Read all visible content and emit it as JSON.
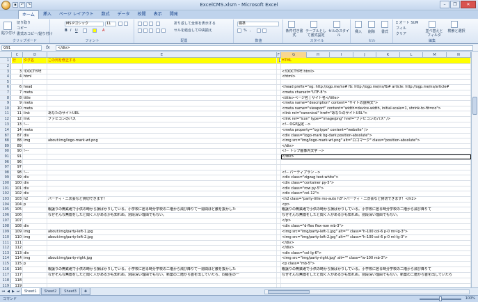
{
  "app": {
    "title": "ExcelCMS.xlsm - Microsoft Excel"
  },
  "ribbon": {
    "tabs": [
      "ホーム",
      "挿入",
      "ページ レイアウト",
      "数式",
      "データ",
      "校閲",
      "表示",
      "開発"
    ],
    "clipboard": {
      "paste": "貼り付け",
      "cut": "切り取り",
      "copy": "コピー",
      "format_painter": "書式のコピー/貼り付け",
      "label": "クリップボード"
    },
    "font": {
      "name": "MS Pゴシック",
      "size": "11",
      "label": "フォント"
    },
    "alignment": {
      "wrap": "折り返して全体を表示する",
      "merge": "セルを結合して中央揃え",
      "label": "配置"
    },
    "number": {
      "format": "標準",
      "label": "数値"
    },
    "styles": {
      "conditional": "条件付き書式",
      "table": "テーブルとして書式設定",
      "cell": "セルのスタイル",
      "label": "スタイル"
    },
    "cells": {
      "insert": "挿入",
      "delete": "削除",
      "format": "書式",
      "label": "セル"
    },
    "editing": {
      "autosum": "オート SUM",
      "fill": "フィル",
      "clear": "クリア",
      "sort": "並べ替えとフィルタ",
      "find": "検索と選択",
      "label": "編集"
    }
  },
  "formula_bar": {
    "name_box": "G91",
    "fx": "fx",
    "value": "</div>"
  },
  "columns": [
    "C",
    "D",
    "E",
    "F",
    "G",
    "H",
    "I",
    "J",
    "K",
    "L",
    "M",
    "N"
  ],
  "sheet": {
    "header_row": {
      "num": "1",
      "row_col": "行",
      "tag_col": "タグ名",
      "e_col": "この列を修正する",
      "g_col": "HTML"
    },
    "rows": [
      {
        "n": "2",
        "c": "",
        "d": "",
        "e": "",
        "g": ""
      },
      {
        "n": "3",
        "c": "3",
        "d": "!DOCTYPE",
        "e": "",
        "g": "<!DOCTYPE html>"
      },
      {
        "n": "4",
        "c": "4",
        "d": "html",
        "e": "",
        "g": "<html>"
      },
      {
        "n": "5",
        "c": "",
        "d": "",
        "e": "",
        "g": ""
      },
      {
        "n": "6",
        "c": "6",
        "d": "head",
        "e": "",
        "g": "<head prefix=\"og: http://ogp.me/ns# fb: http://ogp.me/ns/fb# article: http://ogp.me/ns/article#"
      },
      {
        "n": "7",
        "c": "7",
        "d": "meta",
        "e": "",
        "g": "<meta charset=\"UTF-8\">"
      },
      {
        "n": "8",
        "c": "8",
        "d": "title",
        "e": "",
        "g": "<title>ページ名 | サイト名</title>"
      },
      {
        "n": "9",
        "c": "9",
        "d": "meta",
        "e": "",
        "g": "<meta name=\"description\" content=\"サイトの説明文\">"
      },
      {
        "n": "10",
        "c": "10",
        "d": "meta",
        "e": "",
        "g": "<meta name=\"viewport\" content=\"width=device-width, initial-scale=1, shrink-to-fit=no\">"
      },
      {
        "n": "11",
        "c": "11",
        "d": "link",
        "e": "あなたのサイトURL",
        "g": "<link rel=\"canonical\" href=\"あなたのサイトURL\">"
      },
      {
        "n": "12",
        "c": "12",
        "d": "link",
        "e": "ファビコンのパス",
        "g": "<link rel=\"icon\" type=\"image/png\" href=\"ファビコンのパス\" />"
      },
      {
        "n": "13",
        "c": "13",
        "d": "!---",
        "e": "",
        "g": "<!-- OGP設定 -->"
      },
      {
        "n": "14",
        "c": "14",
        "d": "meta",
        "e": "",
        "g": "<meta property=\"og:type\" content=\"website\" />"
      },
      {
        "n": "87",
        "c": "87",
        "d": "div",
        "e": "",
        "g": "  <div class=\"logo-mark bg-dark position-absolute\">"
      },
      {
        "n": "88",
        "c": "88",
        "d": "img",
        "e": "about:img/logo-mark-wt.png",
        "g": "    <img src=\"img/logo-mark-wt.png\" alt=\"ロゴマーク\" class=\"position-absolute\">"
      },
      {
        "n": "89",
        "c": "89",
        "d": "",
        "e": "",
        "g": "  </div>"
      },
      {
        "n": "90",
        "c": "90",
        "d": "!---",
        "e": "",
        "g": "  <!-- トップ画像内文字 -->"
      },
      {
        "n": "91",
        "c": "91",
        "d": "",
        "e": "",
        "g": "</div>"
      },
      {
        "n": "96",
        "c": "96",
        "d": "",
        "e": "",
        "g": ""
      },
      {
        "n": "97",
        "c": "97",
        "d": "",
        "e": "",
        "g": ""
      },
      {
        "n": "98",
        "c": "98",
        "d": "!---",
        "e": "",
        "g": "<!-- パーティプラン -->"
      },
      {
        "n": "99",
        "c": "99",
        "d": "div",
        "e": "",
        "g": "<div class=\"zigzag text-white\">"
      },
      {
        "n": "100",
        "c": "100",
        "d": "div",
        "e": "",
        "g": "  <div class=\"container py-5\">"
      },
      {
        "n": "101",
        "c": "101",
        "d": "div",
        "e": "",
        "g": "    <div class=\"row py-5\">"
      },
      {
        "n": "102",
        "c": "102",
        "d": "div",
        "e": "",
        "g": "      <div class=\"col-12\">"
      },
      {
        "n": "103",
        "c": "103",
        "d": "h2",
        "e": "パーティ・二次会など貸切できます！",
        "g": "        <h2 class=\"party-title mx-auto h3\">パーティ・二次会など貸切できます！</h2>"
      },
      {
        "n": "104",
        "c": "104",
        "d": "p",
        "e": "",
        "g": "        <p>"
      },
      {
        "n": "105",
        "c": "105",
        "d": "",
        "e": "親譲りの無鉄砲で小供の時から損ばかりしている。小学校に居る時分学校の二階から飛び降りて一週間ほど腰を抜かした",
        "g": "          親譲りの無鉄砲で小供の時から損ばかりしている。小学校に居る時分学校の二階から飛び降りて"
      },
      {
        "n": "106",
        "c": "106",
        "d": "",
        "e": "なぜそんな無闇をしたと聞く人があるかも知れぬ。別段深い理由でもない。",
        "g": "          なぜそんな無闇をしたと聞く人があるかも知れぬ。別段深い理由でもない。"
      },
      {
        "n": "107",
        "c": "107",
        "d": "",
        "e": "",
        "g": "        </p>"
      },
      {
        "n": "108",
        "c": "108",
        "d": "div",
        "e": "",
        "g": "      <div class=\"d-flex flex-row mb-3\">"
      },
      {
        "n": "109",
        "c": "109",
        "d": "img",
        "e": "about:img/party-left-1.jpg",
        "g": "        <img src=\"img/party-left-1.jpg\" alt=\"\" class=\"h-100 col-6 p-0 mr-lg-3\">"
      },
      {
        "n": "110",
        "c": "110",
        "d": "img",
        "e": "about:img/party-left-2.jpg",
        "g": "        <img src=\"img/party-left-2.jpg\" alt=\"\" class=\"h-100 col-6 p-0 ml-lg-3\">"
      },
      {
        "n": "111",
        "c": "111",
        "d": "",
        "e": "",
        "g": "      </div>"
      },
      {
        "n": "112",
        "c": "112",
        "d": "",
        "e": "",
        "g": "    </div>"
      },
      {
        "n": "113",
        "c": "113",
        "d": "div",
        "e": "",
        "g": "    <div class=\"col-lg-6\">"
      },
      {
        "n": "114",
        "c": "114",
        "d": "img",
        "e": "about:img/party-right.jpg",
        "g": "      <img src=\"img/party-right.jpg\" alt=\"\" class=\"w-100 mb-3\">"
      },
      {
        "n": "115",
        "c": "115",
        "d": "p",
        "e": "",
        "g": "      <p class=\"mb-5\">"
      },
      {
        "n": "116",
        "c": "116",
        "d": "",
        "e": "親譲りの無鉄砲で小供の時から損ばかりしている。小学校に居る時分学校の二階から飛び降りて一週間ほど腰を抜かした",
        "g": "        親譲りの無鉄砲で小供の時から損ばかりしている。小学校に居る時分学校の二階から飛び降りて"
      },
      {
        "n": "117",
        "c": "117",
        "d": "",
        "e": "なぜそんな無闇をしたと聞く人があるかも知れぬ。別段深い理由でもない。新築の二階から首を出していたら、同級生の一",
        "g": "        なぜそんな無闇をしたと聞く人があるかも知れぬ。別段深い理由でもない。新築の二階から首を出していたら"
      },
      {
        "n": "118",
        "c": "118",
        "d": "",
        "e": "",
        "g": ""
      },
      {
        "n": "119",
        "c": "119",
        "d": "",
        "e": "",
        "g": ""
      }
    ],
    "tall_rows": [
      "11",
      "12",
      "103",
      "105",
      "106",
      "109",
      "110",
      "114",
      "116",
      "117"
    ]
  },
  "sheet_tabs": [
    "Sheet1",
    "Sheet2",
    "Sheet3"
  ],
  "status": {
    "ready": "コマンド",
    "zoom": "100%"
  }
}
